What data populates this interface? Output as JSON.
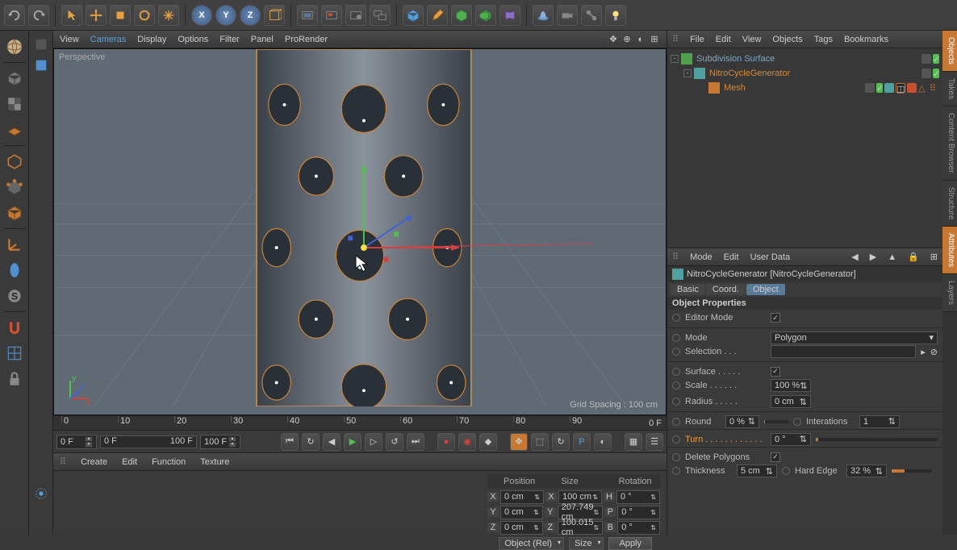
{
  "topbar": {
    "groups": [
      [
        "undo",
        "redo"
      ],
      [
        "select",
        "move-tool",
        "scale-tool",
        "rotate-tool",
        "recent"
      ],
      [
        "axis-x",
        "axis-y",
        "axis-z",
        "coord-sys"
      ],
      [
        "render",
        "render-region",
        "render-settings",
        "render-queue"
      ],
      [
        "primitive",
        "pen",
        "subdivision",
        "extrude",
        "deformer"
      ],
      [
        "camera",
        "light",
        "floor",
        "tags",
        "light-setup"
      ]
    ]
  },
  "left_tools": [
    "model",
    "texture",
    "uv",
    "workplane",
    "object-mode",
    "edge-mode",
    "poly-mode",
    "axis",
    "point",
    "spline",
    "tweak",
    "sculpt",
    "magnet",
    "snap",
    "snap-settings",
    "normals",
    "lock"
  ],
  "viewport": {
    "menus": [
      "View",
      "Cameras",
      "Display",
      "Options",
      "Filter",
      "Panel",
      "ProRender"
    ],
    "hl_index": 1,
    "label": "Perspective",
    "grid_text": "Grid Spacing : 100 cm"
  },
  "timeline": {
    "ticks": [
      "0",
      "10",
      "20",
      "30",
      "40",
      "50",
      "60",
      "70",
      "80",
      "90"
    ],
    "end_label": "0 F",
    "fields": {
      "cur": "0 F",
      "start": "0 F",
      "mid": "100 F",
      "end": "100 F"
    }
  },
  "bottom_menu": [
    "Create",
    "Edit",
    "Function",
    "Texture"
  ],
  "coords": {
    "headers": [
      "Position",
      "Size",
      "Rotation"
    ],
    "rows": [
      {
        "axis": "X",
        "pos": "0 cm",
        "saxis": "X",
        "size": "100 cm",
        "raxis": "H",
        "rot": "0 °"
      },
      {
        "axis": "Y",
        "pos": "0 cm",
        "saxis": "Y",
        "size": "207.749 cm",
        "raxis": "P",
        "rot": "0 °"
      },
      {
        "axis": "Z",
        "pos": "0 cm",
        "saxis": "Z",
        "size": "100.015 cm",
        "raxis": "B",
        "rot": "0 °"
      }
    ],
    "object_dd": "Object (Rel)",
    "size_dd": "Size",
    "apply": "Apply"
  },
  "objects": {
    "menu": [
      "File",
      "Edit",
      "View",
      "Objects",
      "Tags",
      "Bookmarks"
    ],
    "tree": [
      {
        "indent": 0,
        "exp": "-",
        "name": "Subdivision Surface",
        "color": "#7aa7c7",
        "icon": "sds"
      },
      {
        "indent": 1,
        "exp": "-",
        "name": "NitroCycleGenerator",
        "color": "#d88a3a",
        "icon": "gen"
      },
      {
        "indent": 2,
        "exp": "",
        "name": "Mesh",
        "color": "#d88a3a",
        "icon": "mesh",
        "tags": true
      }
    ]
  },
  "attributes": {
    "menu": [
      "Mode",
      "Edit",
      "User Data"
    ],
    "title": "NitroCycleGenerator [NitroCycleGenerator]",
    "tabs": [
      "Basic",
      "Coord.",
      "Object"
    ],
    "active_tab": 2,
    "section": "Object Properties",
    "props": {
      "editor_mode": {
        "label": "Editor Mode",
        "checked": true
      },
      "mode": {
        "label": "Mode",
        "value": "Polygon"
      },
      "selection": {
        "label": "Selection . . .",
        "value": ""
      },
      "surface": {
        "label": "Surface . . . . .",
        "checked": true
      },
      "scale": {
        "label": "Scale . . . . . .",
        "value": "100 %"
      },
      "radius": {
        "label": "Radius . . . . .",
        "value": "0 cm"
      },
      "round": {
        "label": "Round",
        "value": "0 %",
        "pct": 2
      },
      "iterations": {
        "label": "Interations",
        "value": "1"
      },
      "turn": {
        "label": "Turn . . . . . . . . . . . .",
        "value": "0 °",
        "pct": 2,
        "hl": true
      },
      "delete_polygons": {
        "label": "Delete Polygons",
        "checked": true
      },
      "thickness": {
        "label": "Thickness",
        "value": "5 cm"
      },
      "hard_edge": {
        "label": "Hard Edge",
        "value": "32 %",
        "pct": 32
      }
    }
  },
  "right_tabs": [
    "Objects",
    "Takes",
    "Content Browser",
    "Structure",
    "Attributes",
    "Layers"
  ]
}
